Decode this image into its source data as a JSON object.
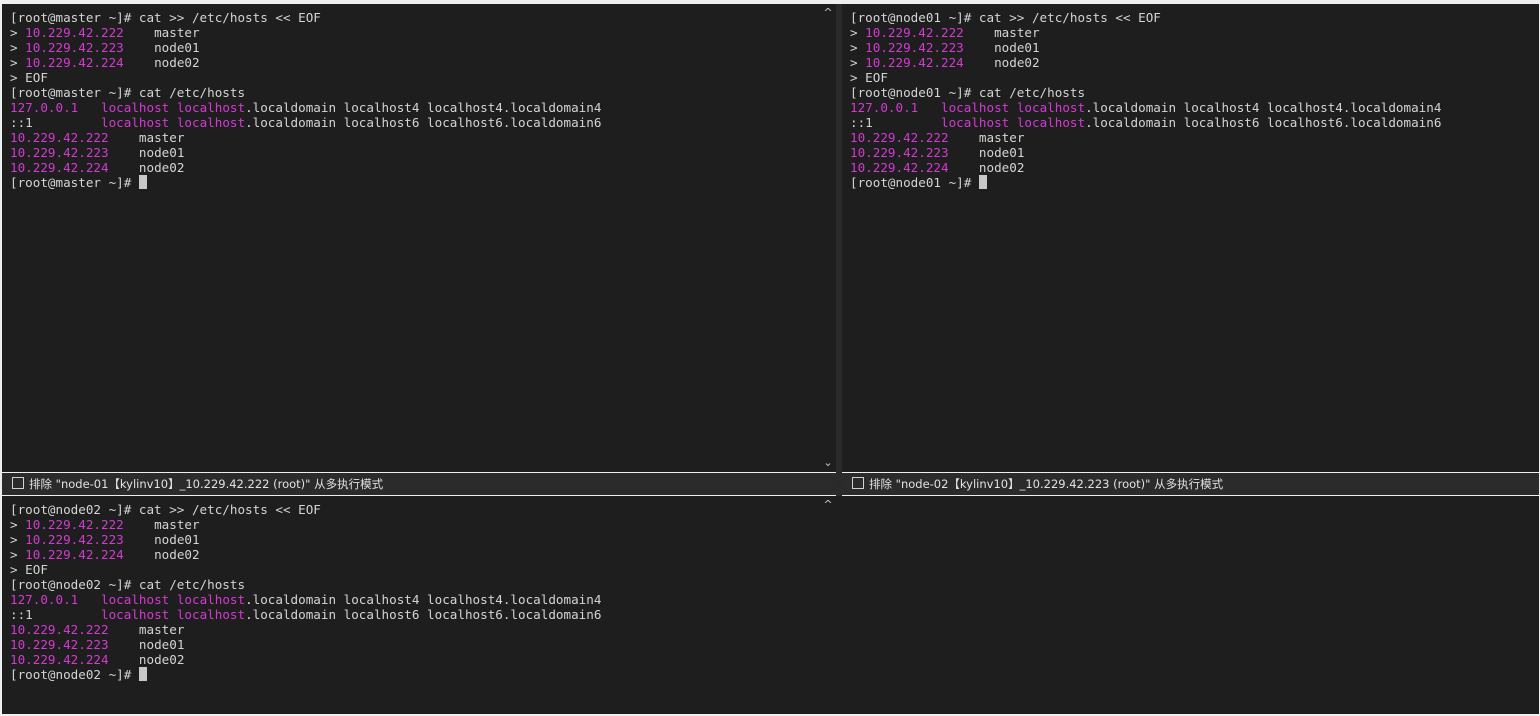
{
  "panes": {
    "top_left": {
      "lines": [
        [
          {
            "t": "[root@master ~]# cat >> /etc/hosts << EOF"
          }
        ],
        [
          {
            "t": "> "
          },
          {
            "t": "10.229.42.222",
            "c": "m"
          },
          {
            "t": "    master"
          }
        ],
        [
          {
            "t": "> "
          },
          {
            "t": "10.229.42.223",
            "c": "m"
          },
          {
            "t": "    node01"
          }
        ],
        [
          {
            "t": "> "
          },
          {
            "t": "10.229.42.224",
            "c": "m"
          },
          {
            "t": "    node02"
          }
        ],
        [
          {
            "t": "> EOF"
          }
        ],
        [
          {
            "t": "[root@master ~]# cat /etc/hosts"
          }
        ],
        [
          {
            "t": "127.0.0.1",
            "c": "m"
          },
          {
            "t": "   "
          },
          {
            "t": "localhost localhost",
            "c": "m"
          },
          {
            "t": ".localdomain localhost4 localhost4.localdomain4"
          }
        ],
        [
          {
            "t": "::1         "
          },
          {
            "t": "localhost localhost",
            "c": "m"
          },
          {
            "t": ".localdomain localhost6 localhost6.localdomain6"
          }
        ],
        [
          {
            "t": "10.229.42.222",
            "c": "m"
          },
          {
            "t": "    master"
          }
        ],
        [
          {
            "t": "10.229.42.223",
            "c": "m"
          },
          {
            "t": "    node01"
          }
        ],
        [
          {
            "t": "10.229.42.224",
            "c": "m"
          },
          {
            "t": "    node02"
          }
        ],
        [
          {
            "t": "[root@master ~]# "
          },
          {
            "cursor": true
          }
        ]
      ]
    },
    "top_right": {
      "lines": [
        [
          {
            "t": "[root@node01 ~]# cat >> /etc/hosts << EOF"
          }
        ],
        [
          {
            "t": "> "
          },
          {
            "t": "10.229.42.222",
            "c": "m"
          },
          {
            "t": "    master"
          }
        ],
        [
          {
            "t": "> "
          },
          {
            "t": "10.229.42.223",
            "c": "m"
          },
          {
            "t": "    node01"
          }
        ],
        [
          {
            "t": "> "
          },
          {
            "t": "10.229.42.224",
            "c": "m"
          },
          {
            "t": "    node02"
          }
        ],
        [
          {
            "t": "> EOF"
          }
        ],
        [
          {
            "t": "[root@node01 ~]# cat /etc/hosts"
          }
        ],
        [
          {
            "t": "127.0.0.1",
            "c": "m"
          },
          {
            "t": "   "
          },
          {
            "t": "localhost localhost",
            "c": "m"
          },
          {
            "t": ".localdomain localhost4 localhost4.localdomain4"
          }
        ],
        [
          {
            "t": "::1         "
          },
          {
            "t": "localhost localhost",
            "c": "m"
          },
          {
            "t": ".localdomain localhost6 localhost6.localdomain6"
          }
        ],
        [
          {
            "t": "10.229.42.222",
            "c": "m"
          },
          {
            "t": "    master"
          }
        ],
        [
          {
            "t": "10.229.42.223",
            "c": "m"
          },
          {
            "t": "    node01"
          }
        ],
        [
          {
            "t": "10.229.42.224",
            "c": "m"
          },
          {
            "t": "    node02"
          }
        ],
        [
          {
            "t": "[root@node01 ~]# "
          },
          {
            "cursor": true
          }
        ]
      ]
    },
    "bottom_left": {
      "lines": [
        [
          {
            "t": "[root@node02 ~]# cat >> /etc/hosts << EOF"
          }
        ],
        [
          {
            "t": "> "
          },
          {
            "t": "10.229.42.222",
            "c": "m"
          },
          {
            "t": "    master"
          }
        ],
        [
          {
            "t": "> "
          },
          {
            "t": "10.229.42.223",
            "c": "m"
          },
          {
            "t": "    node01"
          }
        ],
        [
          {
            "t": "> "
          },
          {
            "t": "10.229.42.224",
            "c": "m"
          },
          {
            "t": "    node02"
          }
        ],
        [
          {
            "t": "> EOF"
          }
        ],
        [
          {
            "t": "[root@node02 ~]# cat /etc/hosts"
          }
        ],
        [
          {
            "t": "127.0.0.1",
            "c": "m"
          },
          {
            "t": "   "
          },
          {
            "t": "localhost localhost",
            "c": "m"
          },
          {
            "t": ".localdomain localhost4 localhost4.localdomain4"
          }
        ],
        [
          {
            "t": "::1         "
          },
          {
            "t": "localhost localhost",
            "c": "m"
          },
          {
            "t": ".localdomain localhost6 localhost6.localdomain6"
          }
        ],
        [
          {
            "t": "10.229.42.222",
            "c": "m"
          },
          {
            "t": "    master"
          }
        ],
        [
          {
            "t": "10.229.42.223",
            "c": "m"
          },
          {
            "t": "    node01"
          }
        ],
        [
          {
            "t": "10.229.42.224",
            "c": "m"
          },
          {
            "t": "    node02"
          }
        ],
        [
          {
            "t": "[root@node02 ~]# "
          },
          {
            "cursor": true
          }
        ]
      ]
    }
  },
  "status": {
    "left_label": "排除 \"node-01【kylinv10】_10.229.42.222 (root)\" 从多执行模式",
    "right_label": "排除 \"node-02【kylinv10】_10.229.42.223 (root)\" 从多执行模式"
  },
  "scroll": {
    "up_glyph": "^",
    "down_glyph": "⌄"
  },
  "colors": {
    "terminal_bg": "#1e1e1e",
    "text": "#d4d4d4",
    "highlight": "#d33ad1",
    "statusbar_bg": "#2b2b2b"
  }
}
